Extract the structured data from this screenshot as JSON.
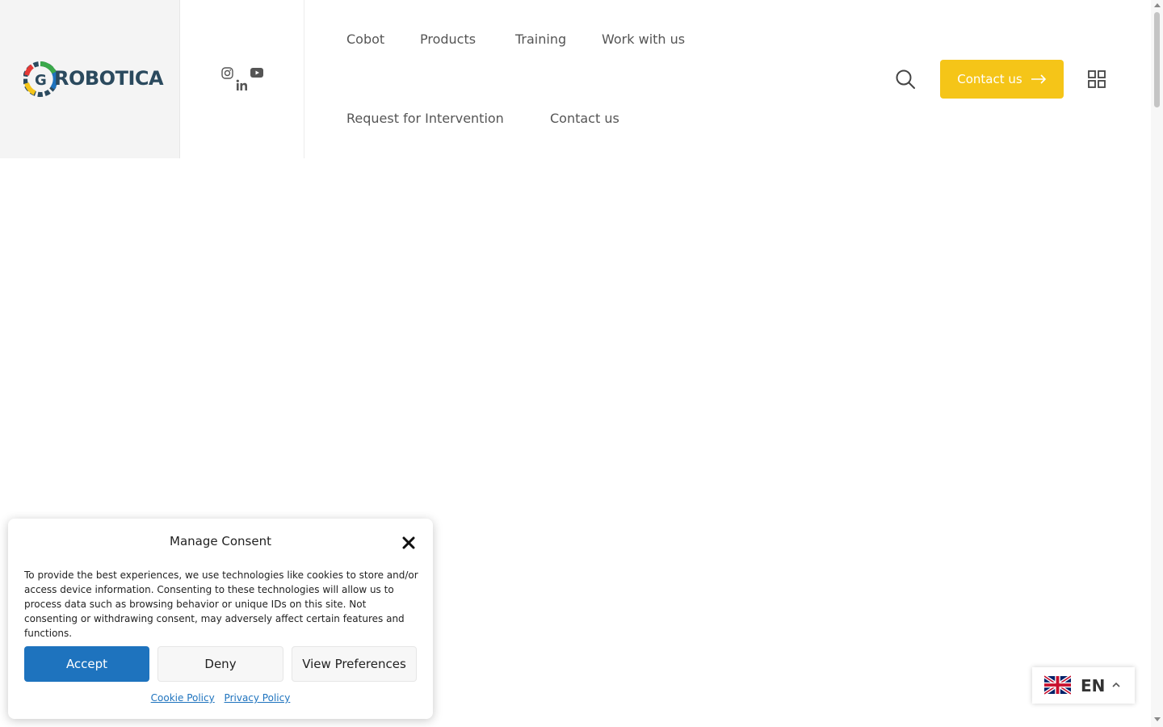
{
  "header": {
    "logo_text": "ROBOTICA",
    "nav": [
      {
        "label": "Cobot"
      },
      {
        "label": "Products"
      },
      {
        "label": "Training"
      },
      {
        "label": "Work with us"
      },
      {
        "label": "Request for Intervention"
      },
      {
        "label": "Contact us"
      }
    ],
    "cta_label": "Contact us",
    "icons": {
      "social": [
        "instagram-icon",
        "youtube-icon",
        "linkedin-icon"
      ],
      "search": "search-icon",
      "menu": "grid-icon",
      "cta_arrow": "arrow-right-icon"
    },
    "colors": {
      "cta": "#f5c518",
      "logo_text": "#2b4a5e"
    }
  },
  "consent": {
    "title": "Manage Consent",
    "text": "To provide the best experiences, we use technologies like cookies to store and/or access device information. Consenting to these technologies will allow us to process data such as browsing behavior or unique IDs on this site. Not consenting or withdrawing consent, may adversely affect certain features and functions.",
    "accept_label": "Accept",
    "deny_label": "Deny",
    "preferences_label": "View Preferences",
    "links": [
      "Cookie Policy",
      "Privacy Policy"
    ],
    "colors": {
      "accept": "#1e73be"
    }
  },
  "language": {
    "code": "EN",
    "flag": "uk-flag-icon"
  }
}
